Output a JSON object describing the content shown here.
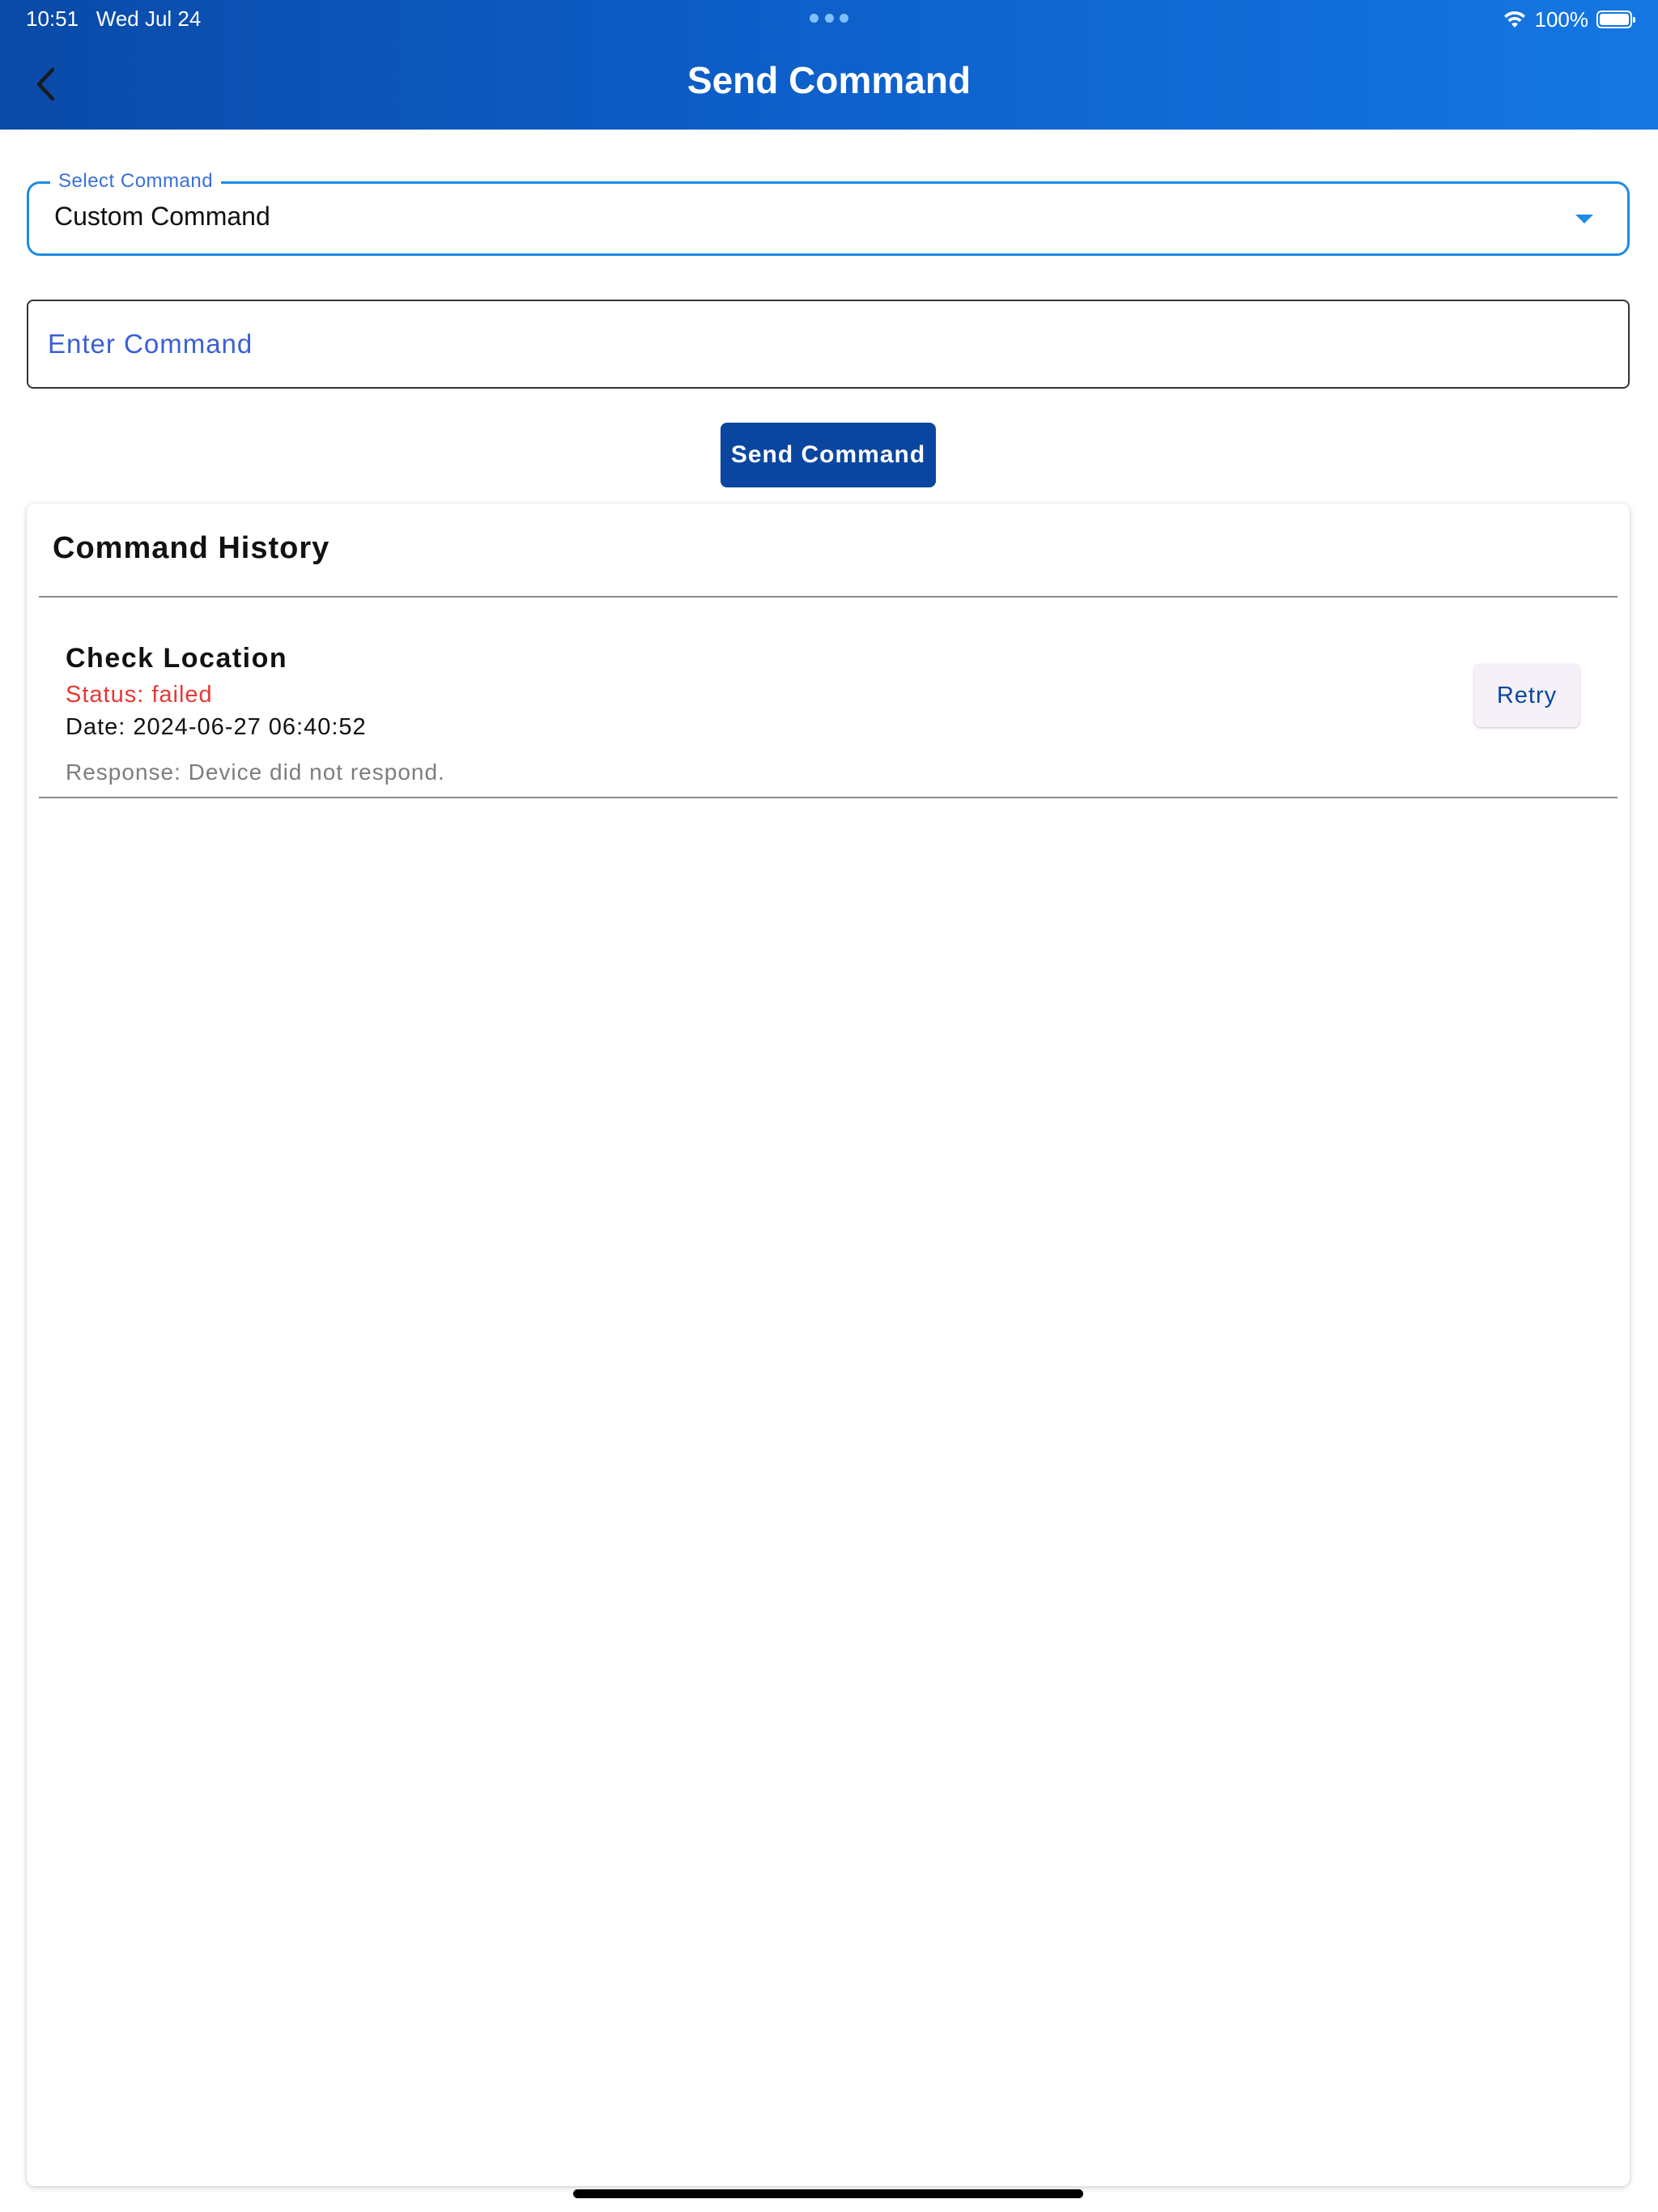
{
  "status_bar": {
    "time": "10:51",
    "date": "Wed Jul 24",
    "battery": "100%",
    "icons": [
      "multitasking-dots-icon",
      "wifi-icon",
      "battery-icon"
    ]
  },
  "header": {
    "title": "Send Command",
    "back_icon": "chevron-left-icon",
    "gradient_colors": [
      "#0a4aa8",
      "#1577e3"
    ]
  },
  "select_command": {
    "label": "Select Command",
    "value": "Custom Command",
    "icon": "dropdown-arrow-icon"
  },
  "command_input": {
    "placeholder": "Enter Command",
    "value": ""
  },
  "send_button": {
    "label": "Send Command",
    "color": "#0a46a0"
  },
  "history": {
    "title": "Command History",
    "items": [
      {
        "name": "Check Location",
        "status": "Status: failed",
        "date": "Date: 2024-06-27 06:40:52",
        "response": "Response: Device did not respond.",
        "retry_label": "Retry",
        "status_color": "#e53935"
      }
    ]
  }
}
